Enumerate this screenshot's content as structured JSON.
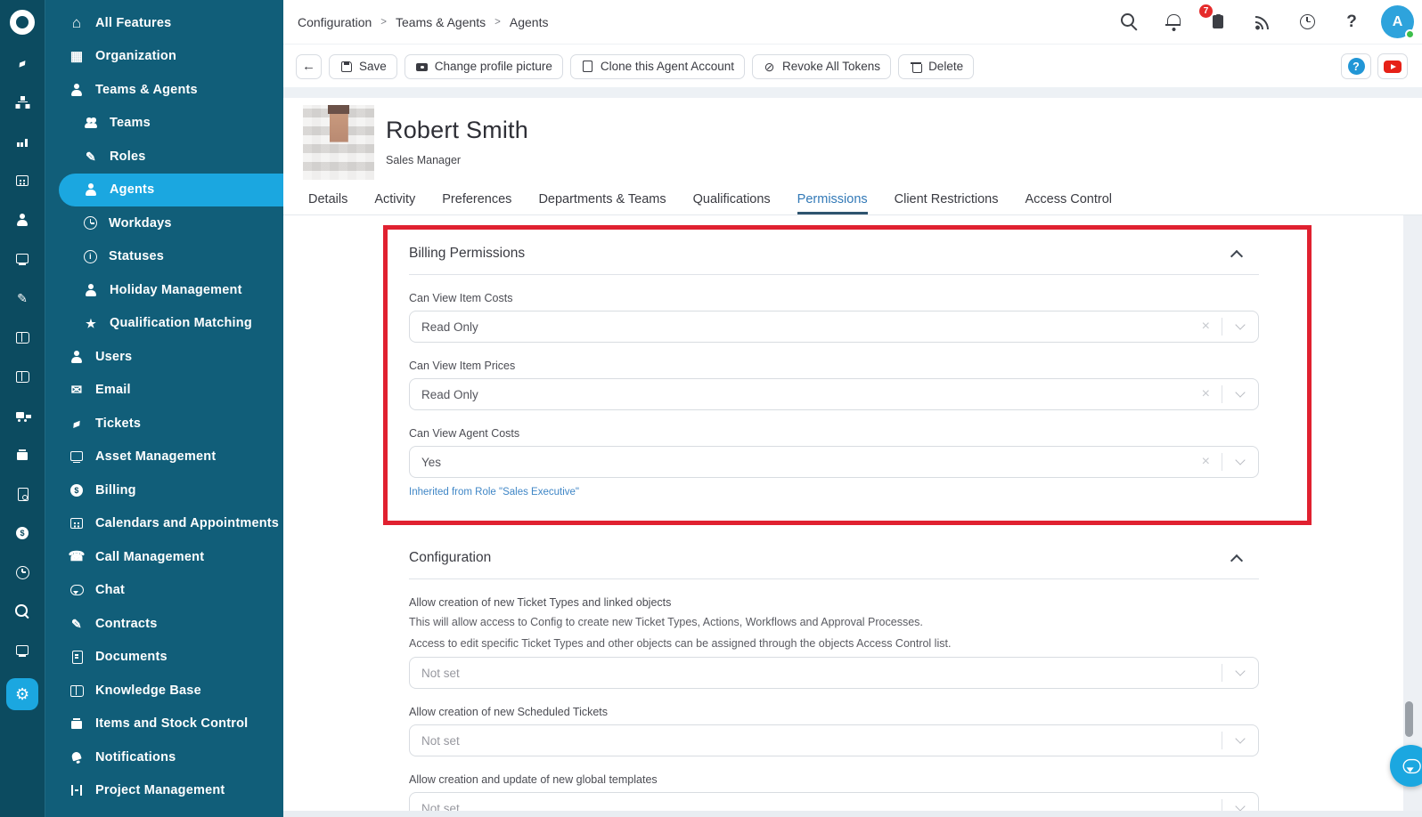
{
  "colors": {
    "accent": "#1ba7e0",
    "sidebar": "#115e79",
    "strip": "#0c4b60",
    "annotation": "#e02130",
    "link": "#3f86c6",
    "tab_active": "#3279b7",
    "badge": "#e52b2b",
    "youtube": "#e62117",
    "online": "#3dbe4a"
  },
  "icon_strip": {
    "items": [
      {
        "icon": "ring",
        "name": "halo-logo",
        "logo": true
      },
      {
        "icon": "ticket",
        "name": "strip-tickets"
      },
      {
        "icon": "sitemap",
        "name": "strip-organization"
      },
      {
        "icon": "chart",
        "name": "strip-reports"
      },
      {
        "icon": "calendar",
        "name": "strip-calendar"
      },
      {
        "icon": "person",
        "name": "strip-users"
      },
      {
        "icon": "monitor",
        "name": "strip-assets"
      },
      {
        "icon": "editdoc",
        "name": "strip-contracts"
      },
      {
        "icon": "book",
        "name": "strip-knowledge"
      },
      {
        "icon": "book",
        "name": "strip-documents"
      },
      {
        "icon": "truck",
        "name": "strip-suppliers"
      },
      {
        "icon": "box",
        "name": "strip-stock"
      },
      {
        "icon": "docsearch",
        "name": "strip-audit"
      },
      {
        "icon": "money",
        "name": "strip-billing"
      },
      {
        "icon": "clock",
        "name": "strip-time"
      },
      {
        "icon": "search",
        "name": "strip-search"
      },
      {
        "icon": "monitor",
        "name": "strip-remote"
      },
      {
        "icon": "gear",
        "name": "strip-configuration",
        "active": true
      }
    ]
  },
  "sidebar": {
    "items": [
      {
        "label": "All Features",
        "icon": "home",
        "name": "sidebar-item-all-features"
      },
      {
        "label": "Organization",
        "icon": "building",
        "name": "sidebar-item-organization"
      },
      {
        "label": "Teams & Agents",
        "icon": "person",
        "name": "sidebar-item-teams-and-agents"
      },
      {
        "label": "Teams",
        "icon": "people",
        "sub": true,
        "name": "sidebar-item-teams"
      },
      {
        "label": "Roles",
        "icon": "editdoc",
        "sub": true,
        "name": "sidebar-item-roles"
      },
      {
        "label": "Agents",
        "icon": "person",
        "sub": true,
        "active": true,
        "name": "sidebar-item-agents"
      },
      {
        "label": "Workdays",
        "icon": "clock",
        "sub": true,
        "name": "sidebar-item-workdays"
      },
      {
        "label": "Statuses",
        "icon": "info",
        "sub": true,
        "name": "sidebar-item-statuses"
      },
      {
        "label": "Holiday Management",
        "icon": "person",
        "sub": true,
        "name": "sidebar-item-holiday-management"
      },
      {
        "label": "Qualification Matching",
        "icon": "medal",
        "sub": true,
        "name": "sidebar-item-qualification-matching"
      },
      {
        "label": "Users",
        "icon": "person",
        "name": "sidebar-item-users"
      },
      {
        "label": "Email",
        "icon": "envelope",
        "name": "sidebar-item-email"
      },
      {
        "label": "Tickets",
        "icon": "ticket",
        "name": "sidebar-item-tickets"
      },
      {
        "label": "Asset Management",
        "icon": "monitor",
        "name": "sidebar-item-asset-management"
      },
      {
        "label": "Billing",
        "icon": "money",
        "name": "sidebar-item-billing"
      },
      {
        "label": "Calendars and Appointments",
        "icon": "calendar",
        "name": "sidebar-item-calendars-and-appointments"
      },
      {
        "label": "Call Management",
        "icon": "phone",
        "name": "sidebar-item-call-management"
      },
      {
        "label": "Chat",
        "icon": "bubble",
        "name": "sidebar-item-chat"
      },
      {
        "label": "Contracts",
        "icon": "editdoc",
        "name": "sidebar-item-contracts"
      },
      {
        "label": "Documents",
        "icon": "doc",
        "name": "sidebar-item-documents"
      },
      {
        "label": "Knowledge Base",
        "icon": "book",
        "name": "sidebar-item-knowledge-base"
      },
      {
        "label": "Items and Stock Control",
        "icon": "box",
        "name": "sidebar-item-items-and-stock-control"
      },
      {
        "label": "Notifications",
        "icon": "bell",
        "name": "sidebar-item-notifications"
      },
      {
        "label": "Project Management",
        "icon": "project",
        "name": "sidebar-item-project-management"
      }
    ]
  },
  "header": {
    "breadcrumb": [
      {
        "label": "Configuration",
        "name": "breadcrumb-configuration"
      },
      {
        "label": "Teams & Agents",
        "name": "breadcrumb-teams-and-agents"
      },
      {
        "label": "Agents",
        "name": "breadcrumb-agents"
      }
    ],
    "badge_count": "7",
    "avatar_initial": "A"
  },
  "toolbar": {
    "buttons": [
      {
        "label": "Save",
        "icon": "save",
        "name": "save-button"
      },
      {
        "label": "Change profile picture",
        "icon": "camera",
        "name": "change-profile-picture-button"
      },
      {
        "label": "Clone this Agent Account",
        "icon": "clone",
        "name": "clone-agent-account-button"
      },
      {
        "label": "Revoke All Tokens",
        "icon": "revoke",
        "name": "revoke-all-tokens-button"
      },
      {
        "label": "Delete",
        "icon": "trash",
        "name": "delete-button"
      }
    ]
  },
  "profile": {
    "name": "Robert Smith",
    "role": "Sales Manager"
  },
  "tabs": [
    {
      "label": "Details",
      "name": "tab-details"
    },
    {
      "label": "Activity",
      "name": "tab-activity"
    },
    {
      "label": "Preferences",
      "name": "tab-preferences"
    },
    {
      "label": "Departments & Teams",
      "name": "tab-departments-and-teams"
    },
    {
      "label": "Qualifications",
      "name": "tab-qualifications"
    },
    {
      "label": "Permissions",
      "name": "tab-permissions",
      "active": true
    },
    {
      "label": "Client Restrictions",
      "name": "tab-client-restrictions"
    },
    {
      "label": "Access Control",
      "name": "tab-access-control"
    }
  ],
  "billing_section": {
    "title": "Billing Permissions",
    "fields": [
      {
        "label": "Can View Item Costs",
        "value": "Read Only",
        "clearable": true
      },
      {
        "label": "Can View Item Prices",
        "value": "Read Only",
        "clearable": true
      },
      {
        "label": "Can View Agent Costs",
        "value": "Yes",
        "clearable": true,
        "note": "Inherited from Role \"Sales Executive\""
      }
    ]
  },
  "configuration_section": {
    "title": "Configuration",
    "fields": [
      {
        "label": "Allow creation of new Ticket Types and linked objects",
        "help1": "This will allow access to Config to create new Ticket Types, Actions, Workflows and Approval Processes.",
        "help2": "Access to edit specific Ticket Types and other objects can be assigned through the objects Access Control list.",
        "value": "Not set",
        "muted": true
      },
      {
        "label": "Allow creation of new Scheduled Tickets",
        "value": "Not set",
        "muted": true
      },
      {
        "label": "Allow creation and update of new global templates",
        "value": "Not set",
        "muted": true
      }
    ]
  }
}
